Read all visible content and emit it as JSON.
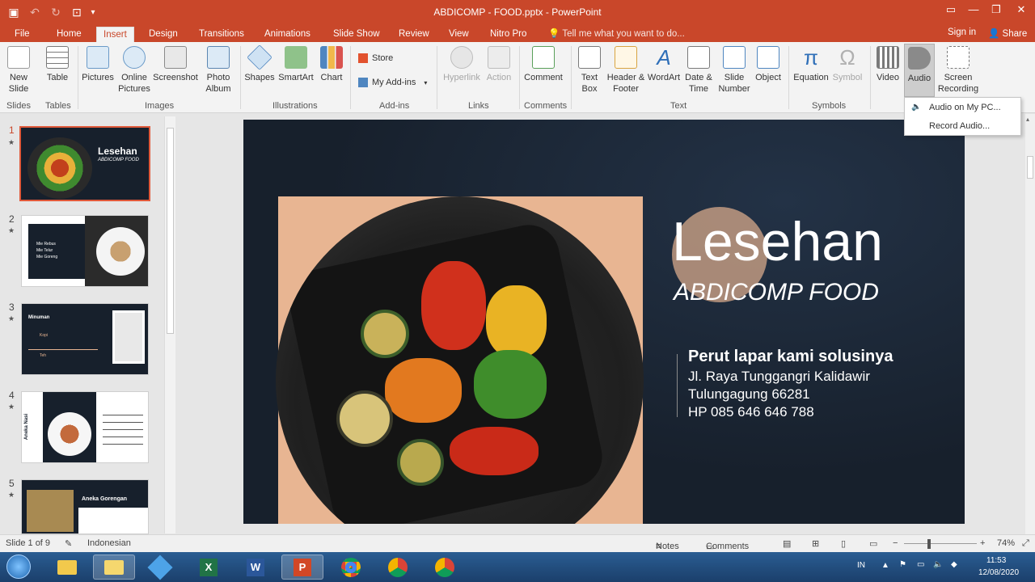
{
  "window": {
    "title": "ABDICOMP - FOOD.pptx - PowerPoint",
    "controls": [
      "restore-ribbon",
      "minimize",
      "maximize",
      "close"
    ]
  },
  "tabs": [
    "File",
    "Home",
    "Insert",
    "Design",
    "Transitions",
    "Animations",
    "Slide Show",
    "Review",
    "View",
    "Nitro Pro"
  ],
  "active_tab": "Insert",
  "tell_me": "Tell me what you want to do...",
  "signin": "Sign in",
  "share": "Share",
  "ribbon": {
    "new_slide": "New Slide",
    "table": "Table",
    "pictures": "Pictures",
    "online_pictures": "Online Pictures",
    "screenshot": "Screenshot",
    "photo_album": "Photo Album",
    "shapes": "Shapes",
    "smartart": "SmartArt",
    "chart": "Chart",
    "store": "Store",
    "my_addins": "My Add-ins",
    "hyperlink": "Hyperlink",
    "action": "Action",
    "comment": "Comment",
    "text_box": "Text Box",
    "header_footer": "Header & Footer",
    "wordart": "WordArt",
    "date_time": "Date & Time",
    "slide_number": "Slide Number",
    "object": "Object",
    "equation": "Equation",
    "symbol": "Symbol",
    "video": "Video",
    "audio": "Audio",
    "screen_recording": "Screen Recording",
    "groups": [
      "Slides",
      "Tables",
      "Images",
      "Illustrations",
      "Add-ins",
      "Links",
      "Comments",
      "Text",
      "Symbols"
    ]
  },
  "audio_menu": [
    "Audio on My PC...",
    "Record Audio..."
  ],
  "thumbnails": [
    {
      "num": "1",
      "title": "Lesehan",
      "subtitle": "ABDICOMP FOOD"
    },
    {
      "num": "2",
      "lines": [
        "Mie Rebus",
        "Mie Telur",
        "Mie Goreng"
      ]
    },
    {
      "num": "3",
      "title": "Minuman",
      "lines": [
        "Kopi",
        "Teh"
      ]
    },
    {
      "num": "4",
      "title": "Aneka Nasi"
    },
    {
      "num": "5",
      "title": "Aneka Gorengan"
    }
  ],
  "slide": {
    "title": "Lesehan",
    "subtitle": "ABDICOMP FOOD",
    "tagline": "Perut lapar kami solusinya",
    "address1": "Jl. Raya Tunggangri Kalidawir",
    "address2": "Tulungagung 66281",
    "phone": "HP 085 646 646 788"
  },
  "status": {
    "slide_of": "Slide 1 of 9",
    "language": "Indonesian",
    "notes": "Notes",
    "comments": "Comments",
    "zoom": "74%"
  },
  "tray": {
    "lang": "IN",
    "time": "11:53",
    "date": "12/08/2020"
  },
  "colors": {
    "accent": "#c9472a",
    "slide_bg": "#17202c",
    "peach": "#e8b592"
  }
}
